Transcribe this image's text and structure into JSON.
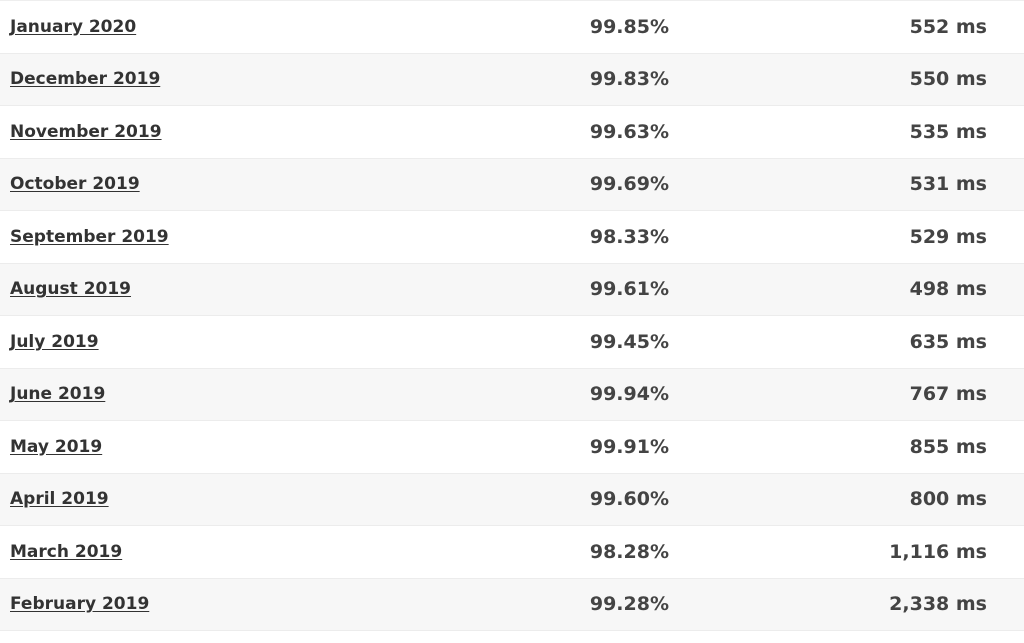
{
  "table": {
    "rows": [
      {
        "month": "January 2020",
        "uptime": "99.85%",
        "response_time": "552 ms"
      },
      {
        "month": "December 2019",
        "uptime": "99.83%",
        "response_time": "550 ms"
      },
      {
        "month": "November 2019",
        "uptime": "99.63%",
        "response_time": "535 ms"
      },
      {
        "month": "October 2019",
        "uptime": "99.69%",
        "response_time": "531 ms"
      },
      {
        "month": "September 2019",
        "uptime": "98.33%",
        "response_time": "529 ms"
      },
      {
        "month": "August 2019",
        "uptime": "99.61%",
        "response_time": "498 ms"
      },
      {
        "month": "July 2019",
        "uptime": "99.45%",
        "response_time": "635 ms"
      },
      {
        "month": "June 2019",
        "uptime": "99.94%",
        "response_time": "767 ms"
      },
      {
        "month": "May 2019",
        "uptime": "99.91%",
        "response_time": "855 ms"
      },
      {
        "month": "April 2019",
        "uptime": "99.60%",
        "response_time": "800 ms"
      },
      {
        "month": "March 2019",
        "uptime": "98.28%",
        "response_time": "1,116 ms"
      },
      {
        "month": "February 2019",
        "uptime": "99.28%",
        "response_time": "2,338 ms"
      }
    ]
  }
}
